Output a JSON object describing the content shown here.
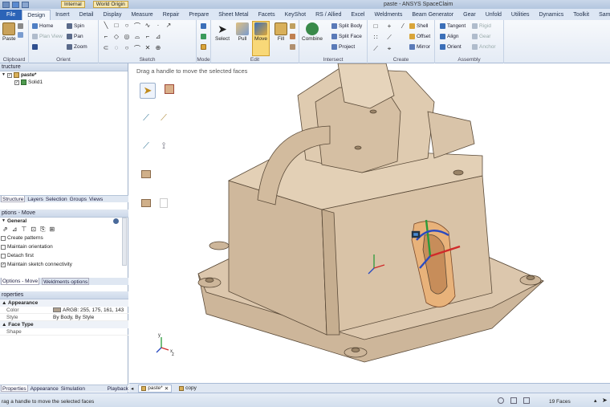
{
  "titlebar": {
    "dropdown1": "Internal",
    "dropdown2": "World Origin",
    "title": "paste - ANSYS SpaceClaim"
  },
  "tabs": [
    "File",
    "Design",
    "Insert",
    "Detail",
    "Display",
    "Measure",
    "Repair",
    "Prepare",
    "Sheet Metal",
    "Facets",
    "KeyShot",
    "RS / Allied",
    "Excel",
    "Weldments",
    "Beam Generator",
    "Gear",
    "Unfold",
    "Utilities",
    "Dynamics",
    "Toolkit",
    "Sample C# ["
  ],
  "ribbon": {
    "clipboard": {
      "paste": "Paste",
      "label": "Clipboard"
    },
    "orient": {
      "home": "Home",
      "spin": "Spin",
      "plan_view": "Plan View",
      "pan": "Pan",
      "zoom": "Zoom",
      "label": "Orient"
    },
    "sketch": {
      "label": "Sketch"
    },
    "mode": {
      "label": "Mode"
    },
    "edit": {
      "select": "Select",
      "pull": "Pull",
      "move": "Move",
      "fill": "Fill",
      "label": "Edit"
    },
    "intersect": {
      "combine": "Combine",
      "split_body": "Split Body",
      "split_face": "Split Face",
      "project": "Project",
      "label": "Intersect"
    },
    "create": {
      "shell": "Shell",
      "offset": "Offset",
      "mirror": "Mirror",
      "label": "Create"
    },
    "assembly": {
      "tangent": "Tangent",
      "align": "Align",
      "orient": "Orient",
      "rigid": "Rigid",
      "gear": "Gear",
      "anchor": "Anchor",
      "label": "Assembly"
    }
  },
  "structure": {
    "header": "tructure",
    "root": "paste*",
    "child": "Solid1",
    "tabs": [
      "Structure",
      "Layers",
      "Selection",
      "Groups",
      "Views"
    ]
  },
  "options": {
    "header": "ptions - Move",
    "section": "General",
    "items": [
      "Create patterns",
      "Maintain orientation",
      "Detach first",
      "Maintain sketch connectivity"
    ],
    "tabs": [
      "Options - Move",
      "Weldments options"
    ]
  },
  "properties": {
    "header": "roperties",
    "appearance": "Appearance",
    "color_key": "Color",
    "color_val": "ARGB: 255, 175, 161, 143",
    "style_key": "Style",
    "style_val": "By Body, By Style",
    "face_type": "Face Type",
    "shape_key": "Shape",
    "tabs": [
      "Properties",
      "Appearance",
      "Simulation Structure",
      "Playback"
    ]
  },
  "viewport": {
    "hint": "Drag a handle to move the selected faces",
    "triad_y": "y",
    "triad_x": "x",
    "triad_z": "z",
    "model_color": "#d7c2a8"
  },
  "doctabs": [
    "paste*",
    "copy"
  ],
  "status": {
    "text": "rag a handle to move the selected faces",
    "faces": "19 Faces"
  }
}
